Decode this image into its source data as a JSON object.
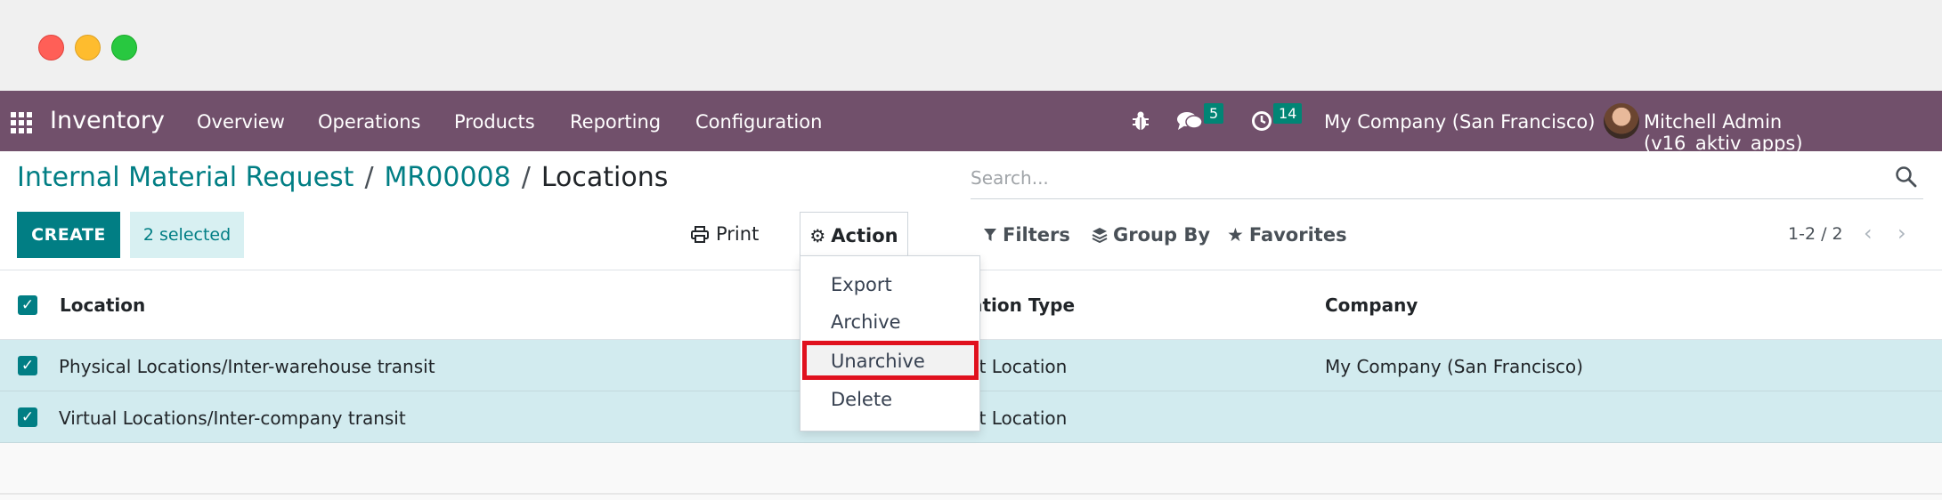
{
  "window": {
    "controls": [
      "close",
      "minimize",
      "maximize"
    ]
  },
  "navbar": {
    "app_name": "Inventory",
    "menu": [
      "Overview",
      "Operations",
      "Products",
      "Reporting",
      "Configuration"
    ],
    "messages_count": "5",
    "activities_count": "14",
    "company": "My Company (San Francisco)",
    "user": "Mitchell Admin (v16_aktiv_apps)",
    "color": "#71506b"
  },
  "breadcrumb": {
    "part1": "Internal Material Request",
    "part2": "MR00008",
    "sep": "/",
    "current": "Locations"
  },
  "controls": {
    "create_label": "CREATE",
    "selected_label": "2 selected",
    "print_label": "Print",
    "action_label": "Action",
    "search_placeholder": "Search...",
    "filters_label": "Filters",
    "groupby_label": "Group By",
    "favorites_label": "Favorites",
    "pager": "1-2 / 2"
  },
  "action_menu": {
    "items": [
      "Export",
      "Archive",
      "Unarchive",
      "Delete"
    ],
    "highlighted": "Unarchive"
  },
  "table": {
    "headers": {
      "location": "Location",
      "type": "ation Type",
      "company": "Company"
    },
    "rows": [
      {
        "location": "Physical Locations/Inter-warehouse transit",
        "type": "it Location",
        "company": "My Company (San Francisco)"
      },
      {
        "location": "Virtual Locations/Inter-company transit",
        "type": "it Location",
        "company": ""
      }
    ]
  },
  "colors": {
    "primary": "#017e84",
    "highlight": "#e0111e",
    "row_selected": "#d2ebef"
  }
}
